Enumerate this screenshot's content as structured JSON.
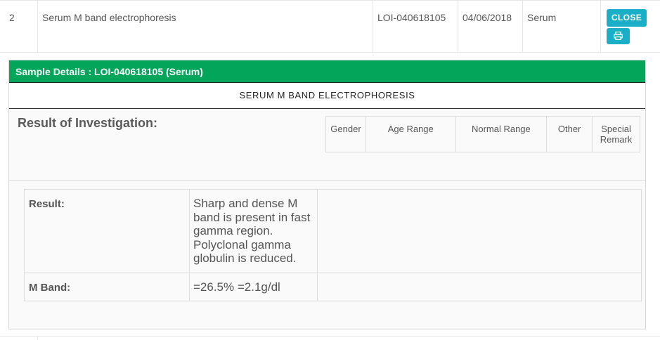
{
  "order": {
    "number": "2",
    "test_name": "Serum M band electrophoresis",
    "reference": "LOI-040618105",
    "date": "04/06/2018",
    "sample_type": "Serum",
    "close_label": "CLOSE",
    "print_icon": "print-icon"
  },
  "panel": {
    "header": "Sample Details : LOI-040618105 (Serum)",
    "test_title": "SERUM M BAND ELECTROPHORESIS",
    "investigation_label": "Result of Investigation:",
    "reference_columns": [
      "Gender",
      "Age Range",
      "Normal Range",
      "Other",
      "Special Remark"
    ],
    "results": [
      {
        "label": "Result:",
        "value": "Sharp and dense M band is present in fast gamma region. Polyclonal gamma globulin is reduced."
      },
      {
        "label": "M Band:",
        "value": "=26.5% =2.1g/dl"
      }
    ]
  },
  "colors": {
    "panel_header_bg": "#02a55a",
    "button_bg": "#1aafc7"
  }
}
